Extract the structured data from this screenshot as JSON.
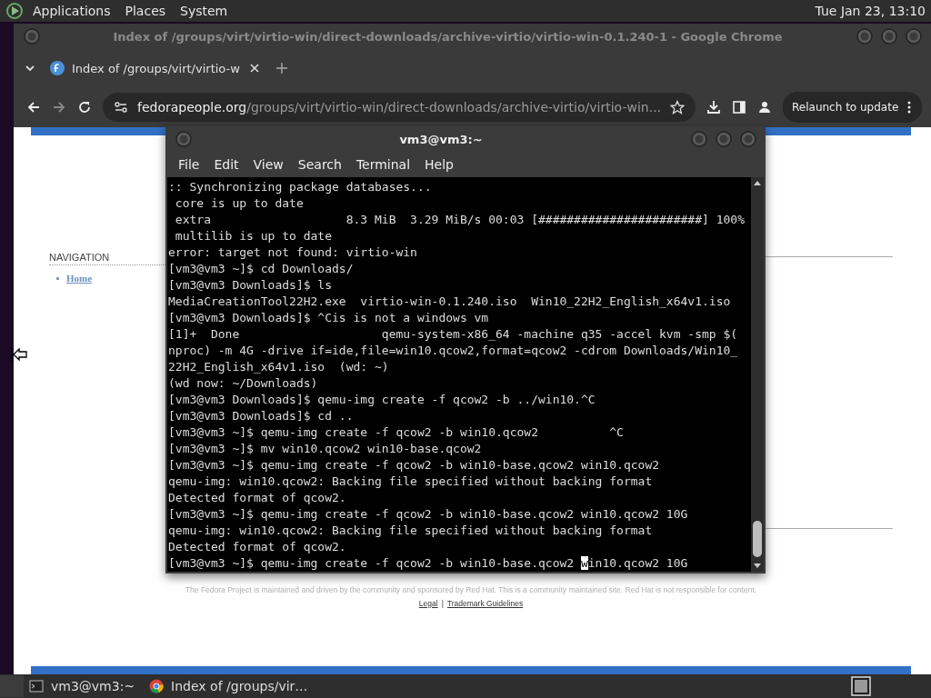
{
  "top_panel": {
    "menus": [
      "Applications",
      "Places",
      "System"
    ],
    "clock": "Tue Jan 23, 13:10"
  },
  "browser": {
    "window_title": "Index of /groups/virt/virtio-win/direct-downloads/archive-virtio/virtio-win-0.1.240-1 - Google Chrome",
    "tabs": [
      {
        "label": "Index of /groups/virt/virtio-w",
        "selected": true
      }
    ],
    "address": {
      "host": "fedorapeople.org",
      "path": "/groups/virt/virtio-win/direct-downloads/archive-virtio/virtio-win..."
    },
    "relaunch_button": "Relaunch to update",
    "page": {
      "navigation_heading": "NAVIGATION",
      "navigation_items": [
        "Home"
      ],
      "footer_text": "The Fedora Project is maintained and driven by the community and sponsored by Red Hat. This is a community maintained site. Red Hat is not responsible for content.",
      "footer_links": [
        "Legal",
        "Trademark Guidelines"
      ],
      "footer_separator": "|"
    }
  },
  "terminal": {
    "title": "vm3@vm3:~",
    "menus": [
      "File",
      "Edit",
      "View",
      "Search",
      "Terminal",
      "Help"
    ],
    "lines": [
      ":: Synchronizing package databases...",
      " core is up to date",
      " extra                   8.3 MiB  3.29 MiB/s 00:03 [#######################] 100%",
      " multilib is up to date",
      "error: target not found: virtio-win",
      "[vm3@vm3 ~]$ cd Downloads/",
      "[vm3@vm3 Downloads]$ ls",
      "MediaCreationTool22H2.exe  virtio-win-0.1.240.iso  Win10_22H2_English_x64v1.iso",
      "[vm3@vm3 Downloads]$ ^Cis is not a windows vm",
      "[1]+  Done                    qemu-system-x86_64 -machine q35 -accel kvm -smp $(",
      "nproc) -m 4G -drive if=ide,file=win10.qcow2,format=qcow2 -cdrom Downloads/Win10_",
      "22H2_English_x64v1.iso  (wd: ~)",
      "(wd now: ~/Downloads)",
      "[vm3@vm3 Downloads]$ qemu-img create -f qcow2 -b ../win10.^C",
      "[vm3@vm3 Downloads]$ cd ..",
      "[vm3@vm3 ~]$ qemu-img create -f qcow2 -b win10.qcow2          ^C",
      "[vm3@vm3 ~]$ mv win10.qcow2 win10-base.qcow2",
      "[vm3@vm3 ~]$ qemu-img create -f qcow2 -b win10-base.qcow2 win10.qcow2",
      "qemu-img: win10.qcow2: Backing file specified without backing format",
      "Detected format of qcow2.",
      "[vm3@vm3 ~]$ qemu-img create -f qcow2 -b win10-base.qcow2 win10.qcow2 10G",
      "qemu-img: win10.qcow2: Backing file specified without backing format",
      "Detected format of qcow2."
    ],
    "input_line": {
      "before": "[vm3@vm3 ~]$ qemu-img create -f qcow2 -b win10-base.qcow2 ",
      "cursor": "w",
      "after": "in10.qcow2 10G"
    }
  },
  "taskbar": {
    "tasks": [
      {
        "kind": "terminal",
        "label": "vm3@vm3:~",
        "selected": false
      },
      {
        "kind": "browser",
        "label": "Index of /groups/vir…",
        "selected": false
      }
    ]
  }
}
